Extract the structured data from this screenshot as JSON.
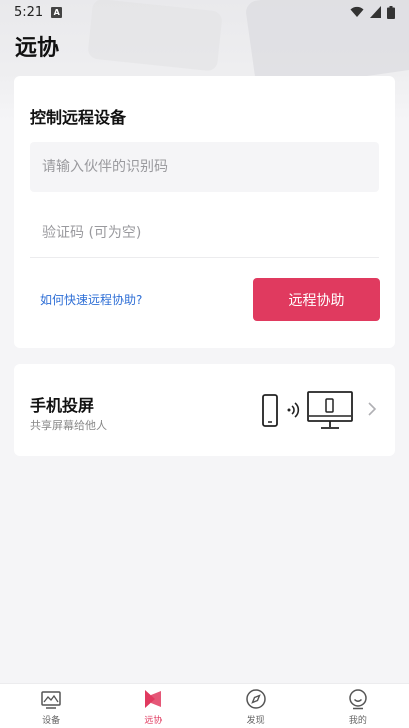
{
  "status_bar": {
    "time": "5:21",
    "notification_icon": "a-badge-icon",
    "wifi_icon": "wifi-icon",
    "signal_icon": "signal-icon",
    "battery_icon": "battery-icon"
  },
  "page": {
    "title": "远协"
  },
  "remote_card": {
    "title": "控制远程设备",
    "partner_id_placeholder": "请输入伙伴的识别码",
    "partner_id_value": "",
    "verify_code_placeholder": "验证码 (可为空)",
    "verify_code_value": "",
    "help_link": "如何快速远程协助?",
    "action_button": "远程协助",
    "accent_color": "#e03a5f"
  },
  "cast_card": {
    "title": "手机投屏",
    "subtitle": "共享屏幕给他人",
    "illustration_icons": [
      "phone-icon",
      "signal-waves-icon",
      "monitor-icon"
    ],
    "chevron_icon": "chevron-right-icon"
  },
  "bottom_nav": {
    "items": [
      {
        "label": "设备",
        "icon": "devices-icon",
        "active": false
      },
      {
        "label": "远协",
        "icon": "remote-assist-icon",
        "active": true
      },
      {
        "label": "发现",
        "icon": "compass-icon",
        "active": false
      },
      {
        "label": "我的",
        "icon": "profile-icon",
        "active": false
      }
    ]
  }
}
